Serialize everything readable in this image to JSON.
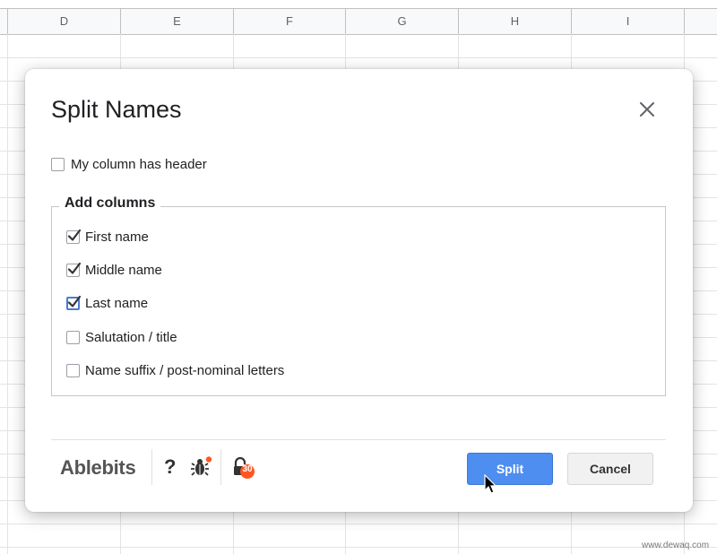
{
  "sheet": {
    "columns": [
      "D",
      "E",
      "F",
      "G",
      "H",
      "I"
    ]
  },
  "dialog": {
    "title": "Split Names",
    "close_icon": "close-icon",
    "header_option": {
      "label": "My column has header",
      "checked": false
    },
    "add_columns": {
      "legend": "Add columns",
      "options": [
        {
          "label": "First name",
          "checked": true
        },
        {
          "label": "Middle name",
          "checked": true
        },
        {
          "label": "Last name",
          "checked": true
        },
        {
          "label": "Salutation / title",
          "checked": false
        },
        {
          "label": "Name suffix / post-nominal letters",
          "checked": false
        }
      ]
    },
    "footer": {
      "brand": "Ablebits",
      "help_label": "?",
      "bug_icon": "bug-icon",
      "lock_icon": "lock-icon",
      "lock_badge": "30",
      "split_label": "Split",
      "cancel_label": "Cancel"
    }
  },
  "colors": {
    "accent": "#4d8ef0",
    "badge": "#ff5722"
  },
  "watermark": "www.dewaq.com"
}
